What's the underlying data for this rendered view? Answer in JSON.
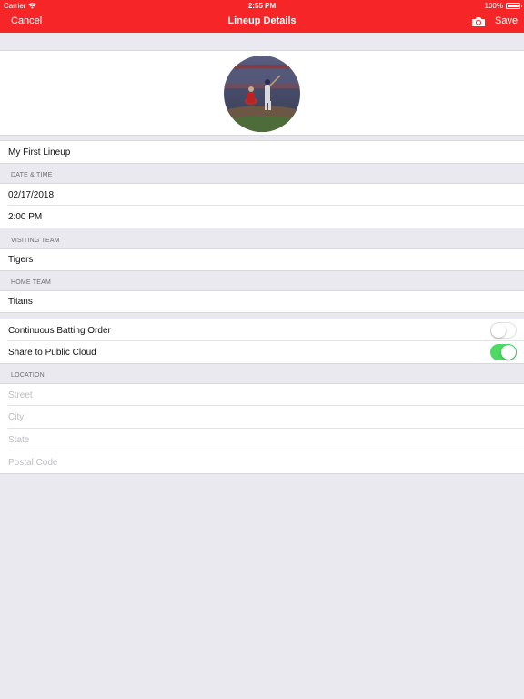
{
  "status_bar": {
    "carrier": "Carrier",
    "time": "2:55 PM",
    "battery": "100%"
  },
  "nav": {
    "cancel_label": "Cancel",
    "title": "Lineup Details",
    "camera_icon": "camera-icon",
    "save_label": "Save"
  },
  "colors": {
    "accent": "#f52528",
    "toggle_on": "#4cd964",
    "background": "#e9e9ef"
  },
  "lineup": {
    "name": "My First Lineup"
  },
  "date_time": {
    "header": "DATE & TIME",
    "date": "02/17/2018",
    "time": "2:00 PM"
  },
  "visiting_team": {
    "header": "VISITING TEAM",
    "name": "Tigers"
  },
  "home_team": {
    "header": "HOME TEAM",
    "name": "Titans"
  },
  "options": {
    "continuous_batting_label": "Continuous Batting Order",
    "continuous_batting_on": false,
    "share_public_label": "Share to Public Cloud",
    "share_public_on": true
  },
  "location": {
    "header": "LOCATION",
    "street_placeholder": "Street",
    "city_placeholder": "City",
    "state_placeholder": "State",
    "postal_placeholder": "Postal Code"
  }
}
